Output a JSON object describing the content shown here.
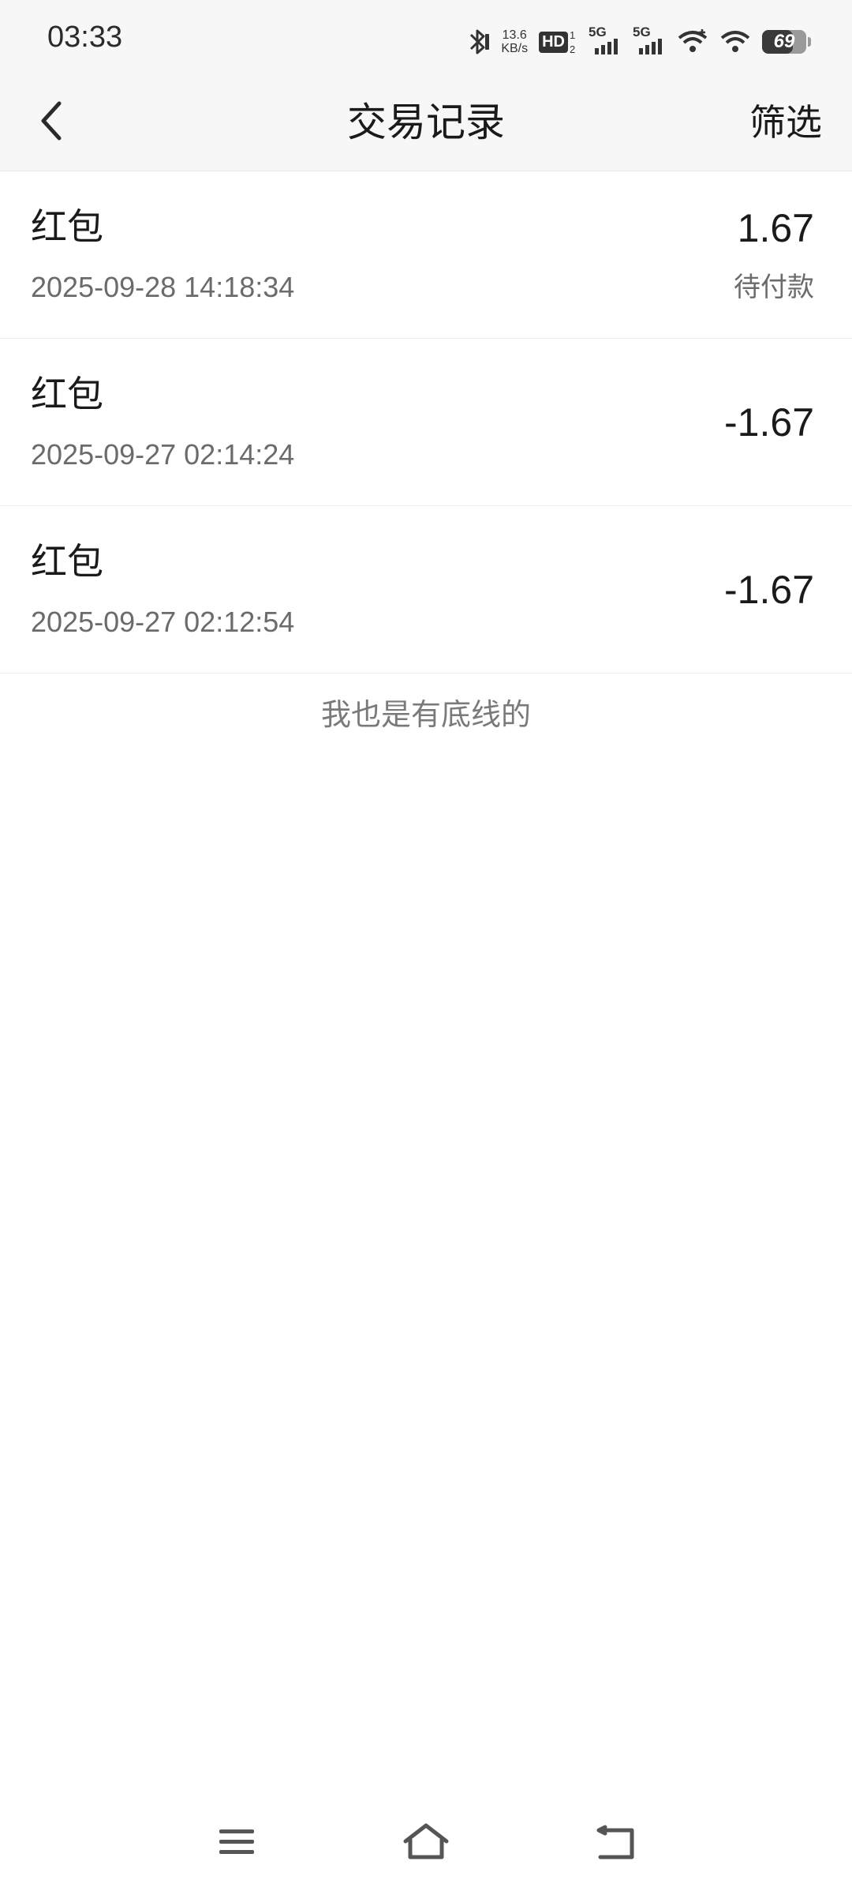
{
  "status_bar": {
    "time": "03:33",
    "network_speed_value": "13.6",
    "network_speed_unit": "KB/s",
    "hd_label": "HD",
    "network_type_1": "5G",
    "network_type_2": "5G",
    "battery_level": "69",
    "battery_fraction": 0.69,
    "icons": [
      "bluetooth-icon",
      "hd-voice-icon",
      "signal-icon",
      "signal-icon",
      "wifi-calling-icon",
      "wifi-icon",
      "battery-icon"
    ]
  },
  "header": {
    "title": "交易记录",
    "filter_label": "筛选",
    "back_icon": "chevron-left-icon"
  },
  "transactions": [
    {
      "title": "红包",
      "time": "2025-09-28 14:18:34",
      "amount": "1.67",
      "status": "待付款"
    },
    {
      "title": "红包",
      "time": "2025-09-27 02:14:24",
      "amount": "-1.67",
      "status": ""
    },
    {
      "title": "红包",
      "time": "2025-09-27 02:12:54",
      "amount": "-1.67",
      "status": ""
    }
  ],
  "footer_note": "我也是有底线的",
  "nav_bar": {
    "icons": [
      "menu-icon",
      "home-icon",
      "back-icon"
    ]
  }
}
